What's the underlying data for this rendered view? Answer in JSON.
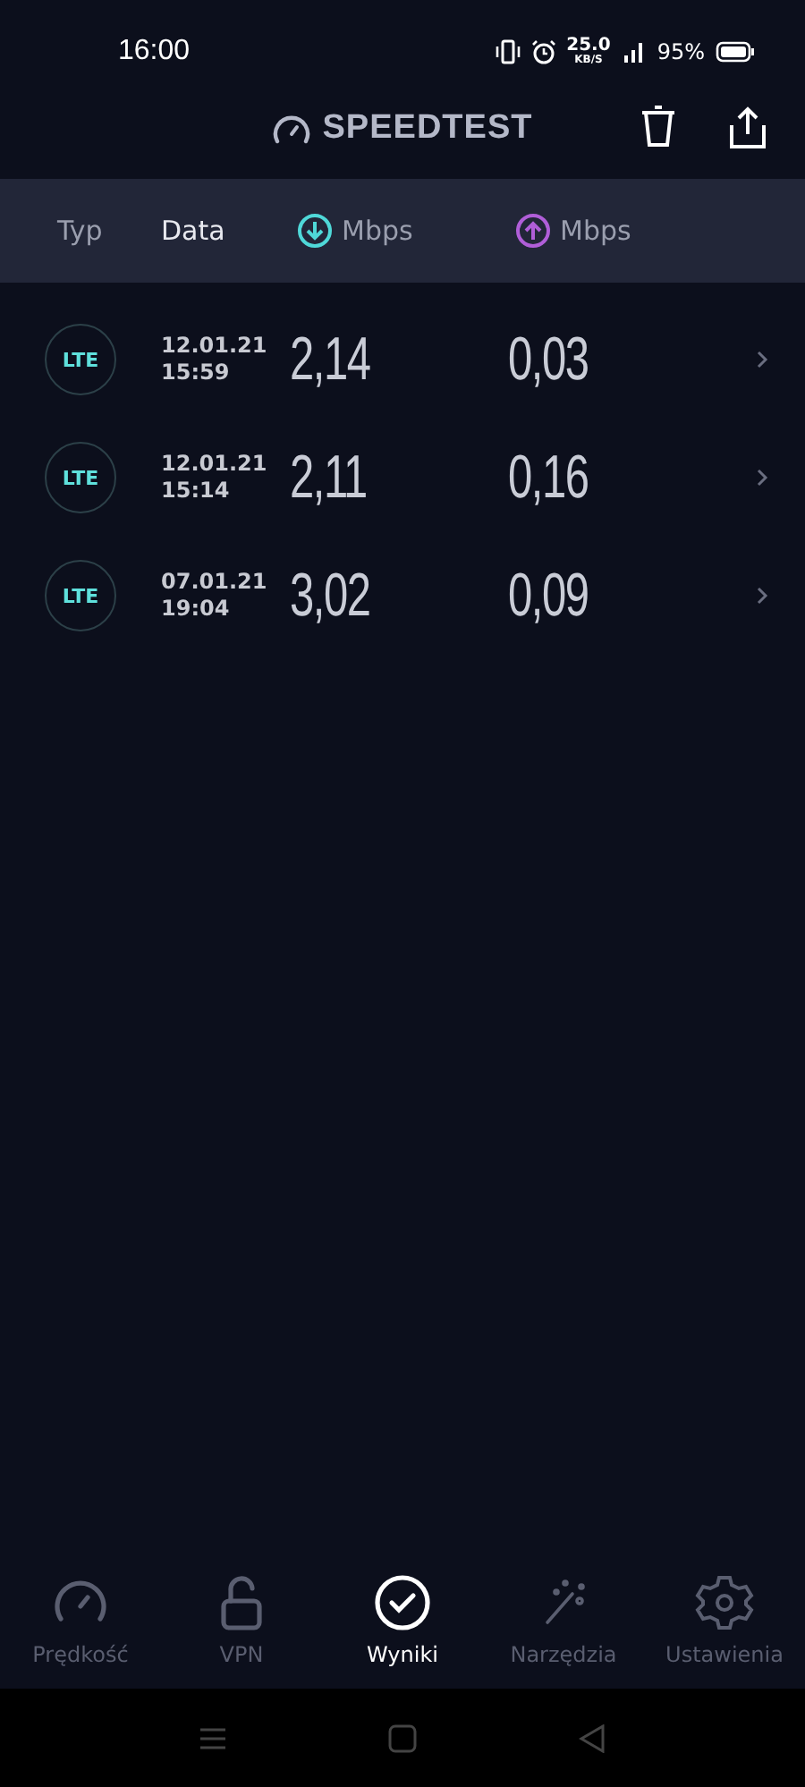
{
  "status_bar": {
    "time": "16:00",
    "net_speed": "25.0",
    "net_unit": "KB/S",
    "battery": "95%"
  },
  "header": {
    "title": "SPEEDTEST"
  },
  "columns": {
    "type": "Typ",
    "date": "Data",
    "download": "Mbps",
    "upload": "Mbps"
  },
  "results": [
    {
      "type": "LTE",
      "date": "12.01.21",
      "time": "15:59",
      "download": "2,14",
      "upload": "0,03"
    },
    {
      "type": "LTE",
      "date": "12.01.21",
      "time": "15:14",
      "download": "2,11",
      "upload": "0,16"
    },
    {
      "type": "LTE",
      "date": "07.01.21",
      "time": "19:04",
      "download": "3,02",
      "upload": "0,09"
    }
  ],
  "nav": [
    {
      "kind": "speed",
      "label": "Prędkość",
      "selected": false
    },
    {
      "kind": "vpn",
      "label": "VPN",
      "selected": false
    },
    {
      "kind": "results",
      "label": "Wyniki",
      "selected": true
    },
    {
      "kind": "tools",
      "label": "Narzędzia",
      "selected": false
    },
    {
      "kind": "settings",
      "label": "Ustawienia",
      "selected": false
    }
  ]
}
